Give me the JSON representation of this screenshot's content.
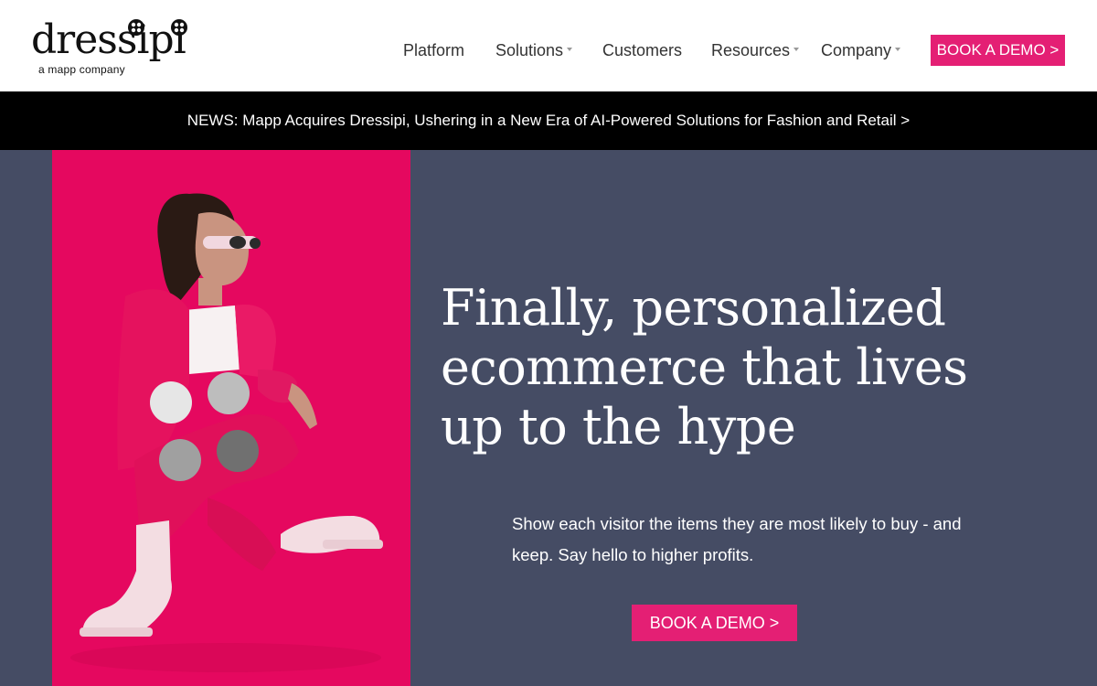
{
  "brand": {
    "name": "dressipi",
    "tagline": "a mapp company"
  },
  "nav": {
    "items": [
      {
        "label": "Platform"
      },
      {
        "label": "Solutions"
      },
      {
        "label": "Customers"
      },
      {
        "label": "Resources"
      },
      {
        "label": "Company"
      }
    ],
    "cta_label": "BOOK A DEMO >"
  },
  "news": {
    "text": "NEWS: Mapp Acquires Dressipi, Ushering in a New Era of AI-Powered Solutions for Fashion and Retail >"
  },
  "hero": {
    "title": "Finally, personalized ecommerce that lives up to the hype",
    "subtitle": "Show each visitor the items they are most likely to buy - and keep. Say hello to higher profits.",
    "cta_label": "BOOK A DEMO >"
  },
  "colors": {
    "accent": "#e41f74",
    "hero_bg": "#454c64",
    "image_bg": "#e5085f",
    "news_bg": "#000000"
  },
  "icons": {
    "logo_dots": "four-dot-button-icon",
    "chevrons": "chevron-down-icon"
  }
}
